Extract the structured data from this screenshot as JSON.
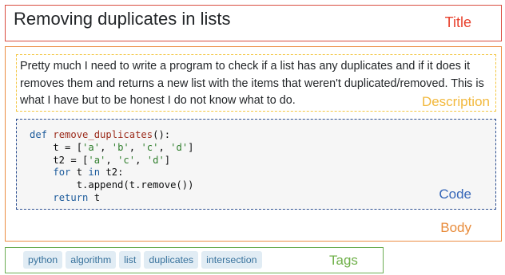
{
  "title": {
    "text": "Removing duplicates in lists",
    "region_label": "Title"
  },
  "body": {
    "region_label": "Body",
    "description": {
      "text": "Pretty much I need to write a program to check if a list has any duplicates and if it does it removes them and returns a new list with the items that weren't duplicated/removed. This is what I have but to be honest I do not know what to do.",
      "region_label": "Description"
    },
    "code": {
      "region_label": "Code",
      "lines": [
        [
          {
            "t": "kw",
            "s": "def"
          },
          {
            "t": "",
            "s": " "
          },
          {
            "t": "fn",
            "s": "remove_duplicates"
          },
          {
            "t": "",
            "s": "():"
          }
        ],
        [
          {
            "t": "",
            "s": "    t = ["
          },
          {
            "t": "st",
            "s": "'a'"
          },
          {
            "t": "",
            "s": ", "
          },
          {
            "t": "st",
            "s": "'b'"
          },
          {
            "t": "",
            "s": ", "
          },
          {
            "t": "st",
            "s": "'c'"
          },
          {
            "t": "",
            "s": ", "
          },
          {
            "t": "st",
            "s": "'d'"
          },
          {
            "t": "",
            "s": "]"
          }
        ],
        [
          {
            "t": "",
            "s": "    t2 = ["
          },
          {
            "t": "st",
            "s": "'a'"
          },
          {
            "t": "",
            "s": ", "
          },
          {
            "t": "st",
            "s": "'c'"
          },
          {
            "t": "",
            "s": ", "
          },
          {
            "t": "st",
            "s": "'d'"
          },
          {
            "t": "",
            "s": "]"
          }
        ],
        [
          {
            "t": "",
            "s": "    "
          },
          {
            "t": "kw",
            "s": "for"
          },
          {
            "t": "",
            "s": " t "
          },
          {
            "t": "kw",
            "s": "in"
          },
          {
            "t": "",
            "s": " t2:"
          }
        ],
        [
          {
            "t": "",
            "s": "        t.append(t.remove())"
          }
        ],
        [
          {
            "t": "",
            "s": "    "
          },
          {
            "t": "kw",
            "s": "return"
          },
          {
            "t": "",
            "s": " t"
          }
        ]
      ]
    }
  },
  "tags": {
    "region_label": "Tags",
    "items": [
      "python",
      "algorithm",
      "list",
      "duplicates",
      "intersection"
    ]
  }
}
